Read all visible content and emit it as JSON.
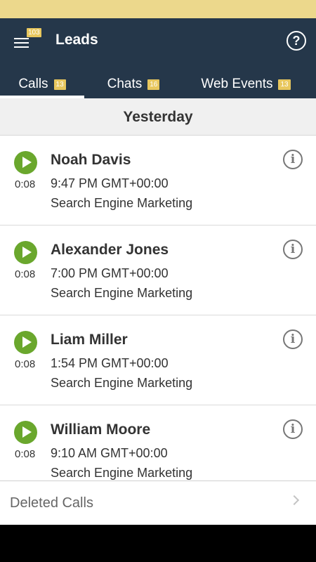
{
  "header": {
    "title": "Leads",
    "menu_badge": "103",
    "help_symbol": "?"
  },
  "tabs": [
    {
      "label": "Calls",
      "count": "13",
      "active": true
    },
    {
      "label": "Chats",
      "count": "16",
      "active": false
    },
    {
      "label": "Web Events",
      "count": "13",
      "active": false
    }
  ],
  "section": {
    "title": "Yesterday"
  },
  "calls": [
    {
      "name": "Noah Davis",
      "duration": "0:08",
      "time": "9:47 PM GMT+00:00",
      "source": "Search Engine Marketing"
    },
    {
      "name": "Alexander Jones",
      "duration": "0:08",
      "time": "7:00 PM GMT+00:00",
      "source": "Search Engine Marketing"
    },
    {
      "name": "Liam Miller",
      "duration": "0:08",
      "time": "1:54 PM GMT+00:00",
      "source": "Search Engine Marketing"
    },
    {
      "name": "William Moore",
      "duration": "0:08",
      "time": "9:10 AM GMT+00:00",
      "source": "Search Engine Marketing"
    }
  ],
  "footer": {
    "deleted_label": "Deleted Calls"
  },
  "icons": {
    "info": "i",
    "play": "play-icon",
    "chevron": "chevron-right-icon"
  },
  "colors": {
    "header_bg": "#25374a",
    "status_bar": "#ecd88c",
    "badge": "#e8c75e",
    "play_green": "#6aa72d"
  }
}
